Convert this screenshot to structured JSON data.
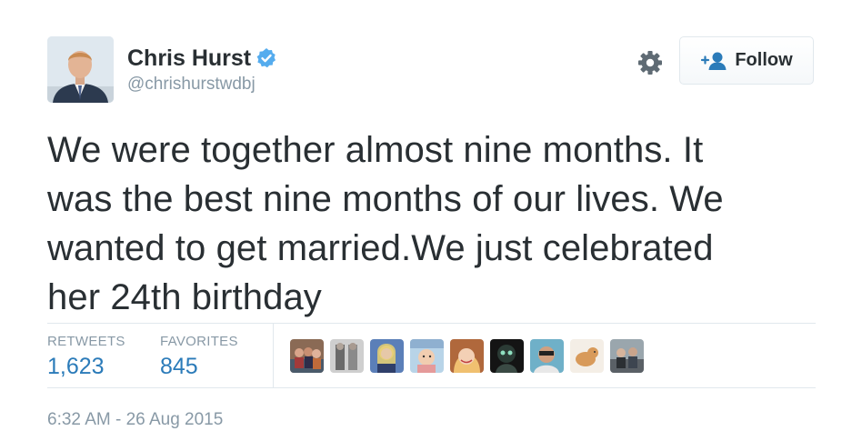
{
  "author": {
    "name": "Chris Hurst",
    "handle": "@chrishurstwdbj",
    "verified": true
  },
  "actions": {
    "follow_label": "Follow",
    "settings_icon": "gear-icon",
    "follow_icon": "add-user-icon"
  },
  "tweet": {
    "lines": [
      "We were together almost nine months. It",
      "was the best nine months of our lives. We",
      "wanted to get married.We just celebrated",
      "her 24th birthday"
    ]
  },
  "stats": {
    "retweets_label": "RETWEETS",
    "retweets_value": "1,623",
    "favorites_label": "FAVORITES",
    "favorites_value": "845"
  },
  "timestamp": "6:32 AM - 26 Aug 2015",
  "colors": {
    "link_blue": "#2b7bb9",
    "verified_blue": "#55acee",
    "muted_gray": "#8899a6",
    "text_dark": "#292f33",
    "border": "#e1e8ed"
  }
}
